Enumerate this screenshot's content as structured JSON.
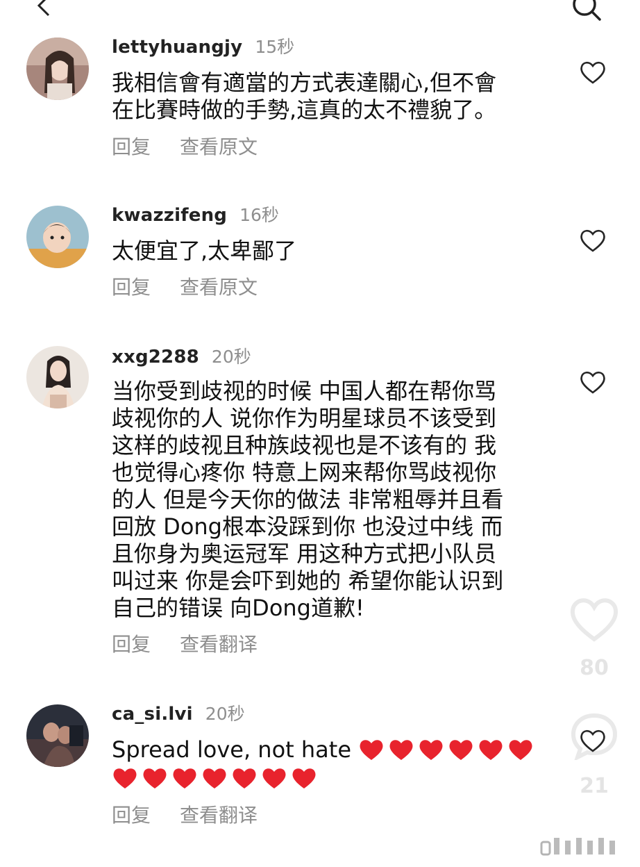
{
  "comments": [
    {
      "username": "lettyhuangjy",
      "time": "15秒",
      "lines": [
        "我相信會有適當的方式表達關心,但不會",
        "在比賽時做的手勢,這真的太不禮貌了。"
      ],
      "reply": "回复",
      "translate": "查看原文"
    },
    {
      "username": "kwazzifeng",
      "time": "16秒",
      "lines": [
        "太便宜了,太卑鄙了"
      ],
      "reply": "回复",
      "translate": "查看原文"
    },
    {
      "username": "xxg2288",
      "time": "20秒",
      "lines": [
        "当你受到歧视的时候 中国人都在帮你骂",
        "歧视你的人 说你作为明星球员不该受到",
        "这样的歧视且种族歧视也是不该有的 我",
        "也觉得心疼你 特意上网来帮你骂歧视你",
        "的人 但是今天你的做法 非常粗辱并且看",
        "回放 Dong根本没踩到你 也没过中线 而",
        "且你身为奥运冠军 用这种方式把小队员",
        "叫过来 你是会吓到她的 希望你能认识到",
        "自己的错误 向Dong道歉!"
      ],
      "reply": "回复",
      "translate": "查看翻译"
    },
    {
      "username": "ca_si.lvi",
      "time": "20秒",
      "text_prefix": "Spread love, not hate",
      "emoji_first_line": 6,
      "emoji_second_line": 7,
      "reply": "回复",
      "translate": "查看翻译"
    }
  ],
  "side_actions": {
    "like_count": "80",
    "comment_count": "21"
  },
  "icons": {
    "back": "chevron-left-icon",
    "search": "search-icon",
    "like": "heart-outline-icon",
    "emoji": "red-heart-emoji"
  },
  "colors": {
    "username": "#222222",
    "meta": "#8e8e8e",
    "heart": "#e8232d"
  }
}
